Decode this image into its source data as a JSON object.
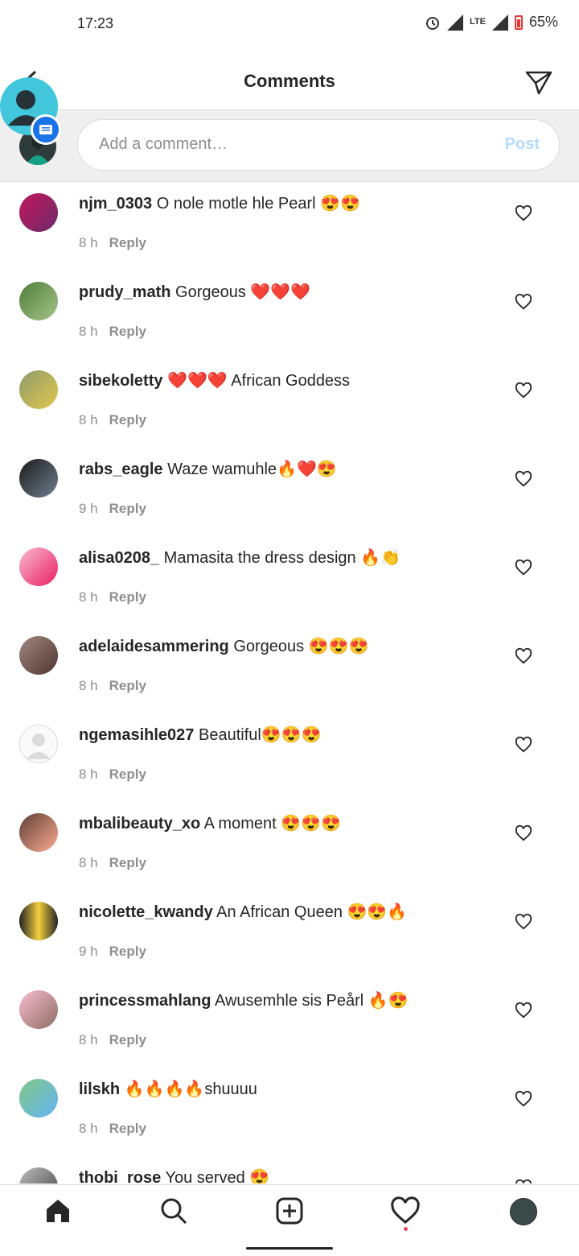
{
  "status": {
    "time": "17:23",
    "network": "LTE",
    "battery": "65%"
  },
  "header": {
    "title": "Comments"
  },
  "composer": {
    "placeholder": "Add a comment…",
    "post_label": "Post"
  },
  "comments": [
    {
      "username": "njm_0303",
      "text": "O nole motle hle Pearl 😍😍",
      "time": "8 h",
      "reply_label": "Reply"
    },
    {
      "username": "prudy_math",
      "text": "Gorgeous ❤️❤️❤️",
      "time": "8 h",
      "reply_label": "Reply"
    },
    {
      "username": "sibekoletty",
      "text": "❤️❤️❤️ African Goddess",
      "time": "8 h",
      "reply_label": "Reply"
    },
    {
      "username": "rabs_eagle",
      "text": "Waze wamuhle🔥❤️😍",
      "time": "9 h",
      "reply_label": "Reply"
    },
    {
      "username": "alisa0208_",
      "text": "Mamasita the dress design 🔥👏",
      "time": "8 h",
      "reply_label": "Reply"
    },
    {
      "username": "adelaidesammering",
      "text": "Gorgeous 😍😍😍",
      "time": "8 h",
      "reply_label": "Reply"
    },
    {
      "username": "ngemasihle027",
      "text": "Beautiful😍😍😍",
      "time": "8 h",
      "reply_label": "Reply"
    },
    {
      "username": "mbalibeauty_xo",
      "text": "A moment 😍😍😍",
      "time": "8 h",
      "reply_label": "Reply"
    },
    {
      "username": "nicolette_kwandy",
      "text": "An African Queen 😍😍🔥",
      "time": "9 h",
      "reply_label": "Reply"
    },
    {
      "username": "princessmahlang",
      "text": "Awusemhle sis Peårl 🔥😍",
      "time": "8 h",
      "reply_label": "Reply"
    },
    {
      "username": "lilskh",
      "text": "🔥🔥🔥🔥shuuuu",
      "time": "8 h",
      "reply_label": "Reply"
    },
    {
      "username": "thobi_rose",
      "text": "You served 😍",
      "time": "",
      "reply_label": ""
    }
  ],
  "tabbar": {
    "items": [
      "home-icon",
      "search-icon",
      "add-post-icon",
      "activity-heart-icon",
      "profile-avatar"
    ]
  },
  "colors": {
    "accent_disabled": "#b3dbff",
    "text": "#262626",
    "muted": "#8e8e8e",
    "notification_dot": "#ed4956",
    "chathead": "#41c6dc",
    "chathead_badge": "#1a73e8"
  }
}
